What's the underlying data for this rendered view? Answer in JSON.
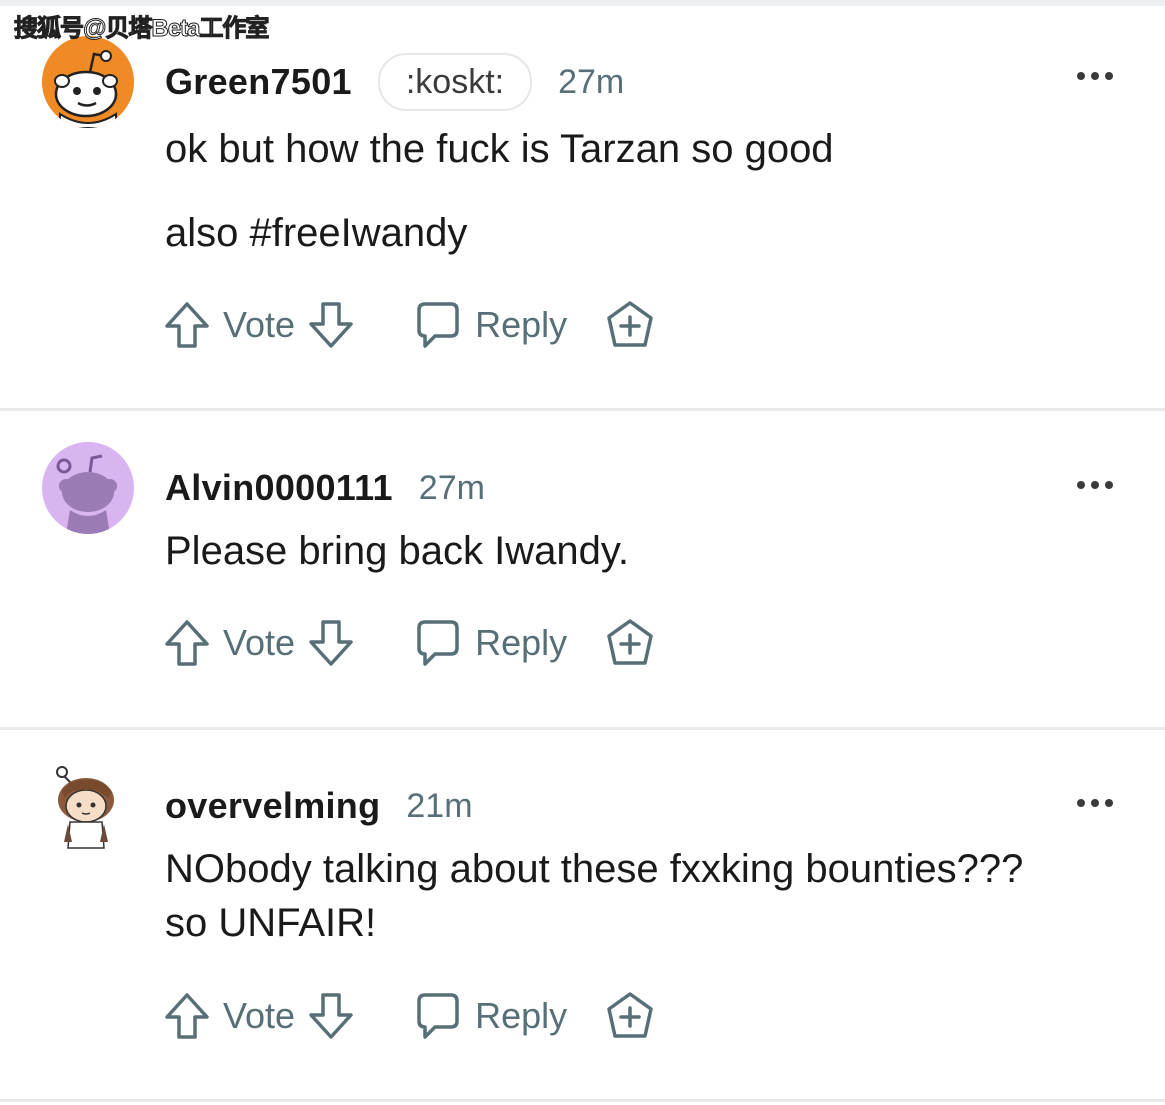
{
  "watermark": "搜狐号@贝塔Beta工作室",
  "comments": [
    {
      "username": "Green7501",
      "flair": ":koskt:",
      "time": "27m",
      "paragraphs": [
        "ok but how the fuck is Tarzan so good",
        "also #freeIwandy"
      ],
      "vote_label": "Vote",
      "reply_label": "Reply"
    },
    {
      "username": "Alvin0000111",
      "time": "27m",
      "paragraphs": [
        "Please bring back Iwandy."
      ],
      "vote_label": "Vote",
      "reply_label": "Reply"
    },
    {
      "username": "overvelming",
      "time": "21m",
      "paragraphs": [
        "NObody talking about these fxxking bounties???",
        "so UNFAIR!"
      ],
      "vote_label": "Vote",
      "reply_label": "Reply"
    }
  ],
  "colors": {
    "text": "#1a1a1b",
    "meta": "#576f76",
    "avatar1_bg": "#f08a24",
    "avatar2_bg": "#d8b4f0",
    "divider": "#e8eaec"
  },
  "icons": [
    "more-icon",
    "upvote-icon",
    "downvote-icon",
    "reply-icon",
    "award-icon"
  ]
}
